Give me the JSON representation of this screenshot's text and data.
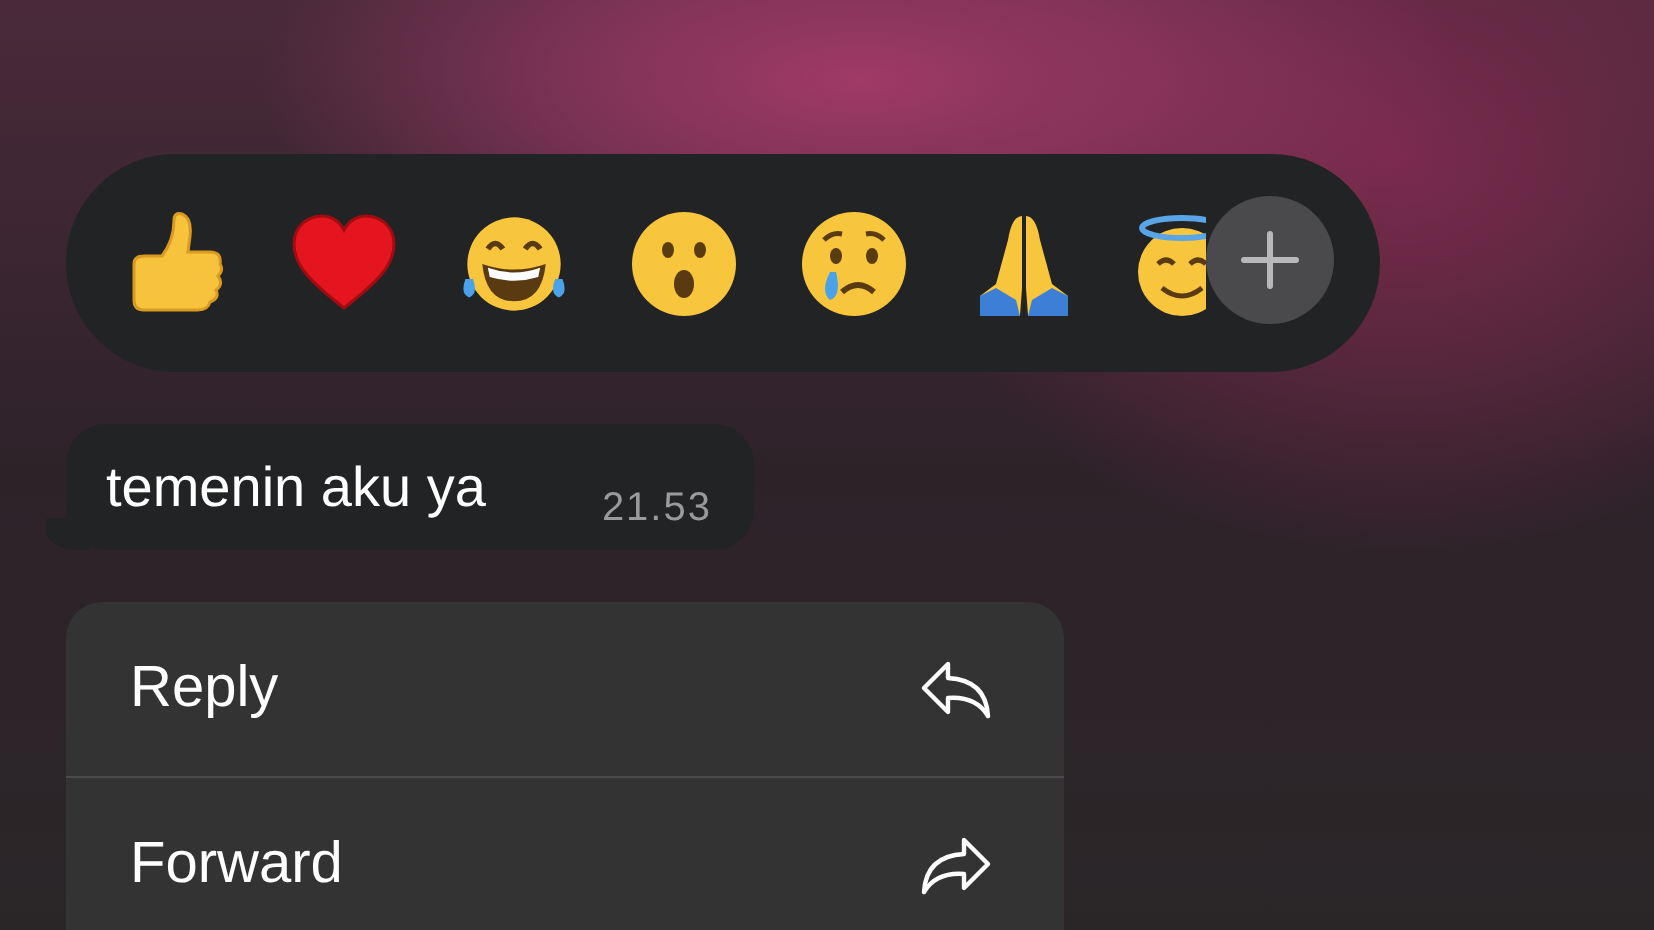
{
  "message": {
    "text": "temenin aku ya",
    "time": "21.53"
  },
  "menu": [
    {
      "kind": "reply",
      "label": "Reply"
    },
    {
      "kind": "forward",
      "label": "Forward"
    }
  ]
}
